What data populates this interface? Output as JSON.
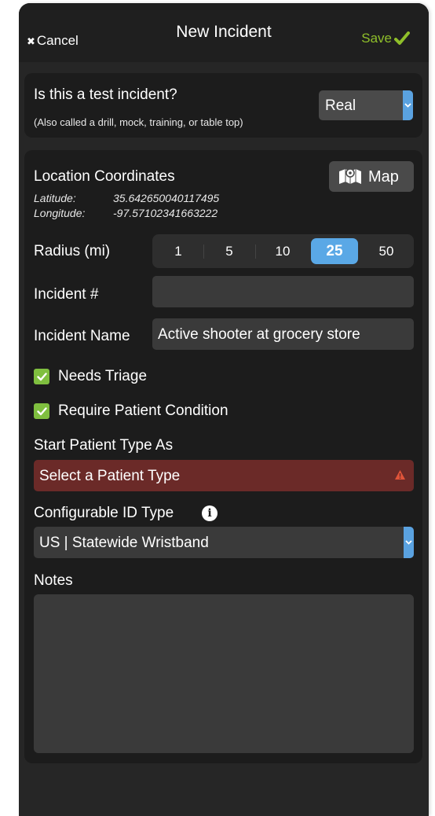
{
  "navbar": {
    "cancel_label": "Cancel",
    "title": "New Incident",
    "save_label": "Save"
  },
  "test_incident": {
    "question": "Is this a test incident?",
    "hint": "(Also called a drill, mock, training, or table top)",
    "selected": "Real"
  },
  "location": {
    "title": "Location Coordinates",
    "map_label": "Map",
    "latitude_label": "Latitude:",
    "latitude_value": "35.642650040117495",
    "longitude_label": "Longitude:",
    "longitude_value": "-97.57102341663222"
  },
  "radius": {
    "label": "Radius (mi)",
    "options": [
      "1",
      "5",
      "10",
      "25",
      "50"
    ],
    "selected": "25"
  },
  "incident_number": {
    "label": "Incident #",
    "value": ""
  },
  "incident_name": {
    "label": "Incident Name",
    "value": "Active shooter at grocery store"
  },
  "checkboxes": {
    "needs_triage": "Needs Triage",
    "require_patient_condition": "Require Patient Condition"
  },
  "patient_type": {
    "label": "Start Patient Type As",
    "placeholder": "Select a Patient Type"
  },
  "configurable_id": {
    "label": "Configurable ID Type",
    "selected": "US | Statewide Wristband"
  },
  "notes": {
    "label": "Notes",
    "value": ""
  },
  "colors": {
    "accent_blue": "#5aa8e6",
    "save_green": "#8fbf2a",
    "check_green": "#7fbf3f",
    "error_red": "#6b2a28",
    "warn_orange": "#e0543a"
  }
}
